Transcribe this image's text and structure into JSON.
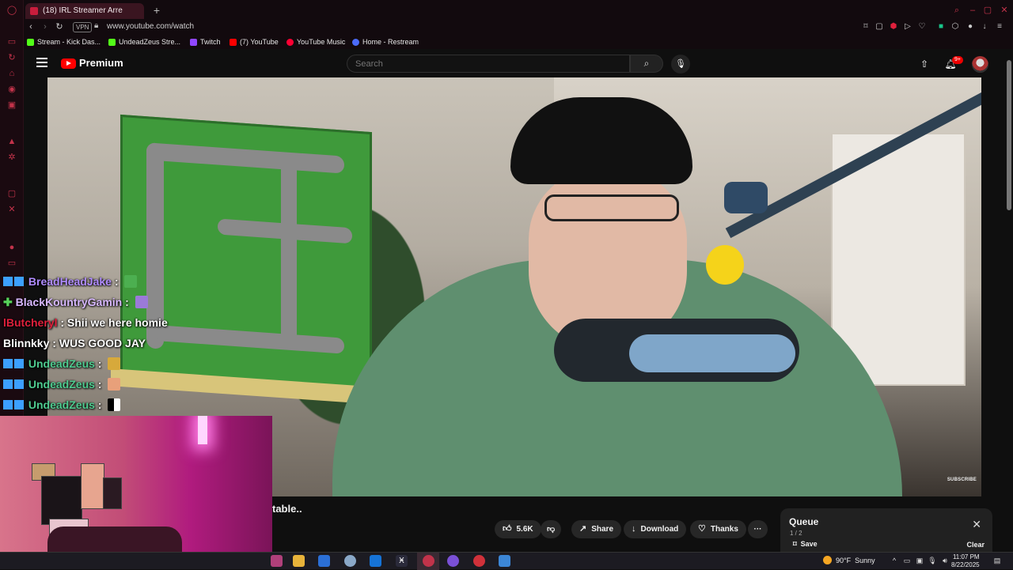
{
  "browser": {
    "tab_title": "(18) IRL Streamer Arre",
    "url": "www.youtube.com/watch",
    "vpn_label": "VPN",
    "bookmarks": [
      {
        "label": "Stream - Kick Das...",
        "color": "#53fc18"
      },
      {
        "label": "UndeadZeus Stre...",
        "color": "#53fc18"
      },
      {
        "label": "Twitch",
        "color": "#9146ff"
      },
      {
        "label": "(7) YouTube",
        "color": "#ff0000"
      },
      {
        "label": "YouTube Music",
        "color": "#ff0033"
      },
      {
        "label": "Home - Restream",
        "color": "#4b6bfb"
      }
    ]
  },
  "youtube": {
    "brand": "Premium",
    "search_placeholder": "Search",
    "notif_count": "9+",
    "video_watermark": "SUBSCRIBE",
    "title_fragment": "table..",
    "actions": {
      "like_count": "5.6K",
      "share": "Share",
      "download": "Download",
      "thanks": "Thanks",
      "more": "···"
    },
    "queue": {
      "title": "Queue",
      "count": "1 / 2",
      "save": "Save",
      "clear": "Clear"
    }
  },
  "chat": [
    {
      "user": "BreadHeadJake",
      "message": "",
      "color": "#b08cff",
      "badge_color": "#3ca0ff",
      "emote_color": "#4caf50"
    },
    {
      "user": "BlackKountryGamin",
      "message": "",
      "color": "#d8b8ff",
      "badge_color": "#58d35a",
      "emote_color": "#9b7ad8"
    },
    {
      "user": "lButcheryl",
      "message": "Shii we here homie",
      "color": "#e0203c",
      "badge_color": "",
      "emote_color": ""
    },
    {
      "user": "Blinnkky",
      "message": "WUS GOOD JAY",
      "color": "#ffffff",
      "badge_color": "",
      "emote_color": ""
    },
    {
      "user": "UndeadZeus",
      "message": "",
      "color": "#4ecb8f",
      "badge_color": "#3ca0ff",
      "emote_color": "#d7a93b"
    },
    {
      "user": "UndeadZeus",
      "message": "",
      "color": "#4ecb8f",
      "badge_color": "#3ca0ff",
      "emote_color": "#e8a07a"
    },
    {
      "user": "UndeadZeus",
      "message": "",
      "color": "#4ecb8f",
      "badge_color": "#3ca0ff",
      "emote_color": "#ffffff"
    }
  ],
  "taskbar": {
    "weather_temp": "90°F",
    "weather_desc": "Sunny",
    "time": "11:07 PM",
    "date": "8/22/2025"
  }
}
